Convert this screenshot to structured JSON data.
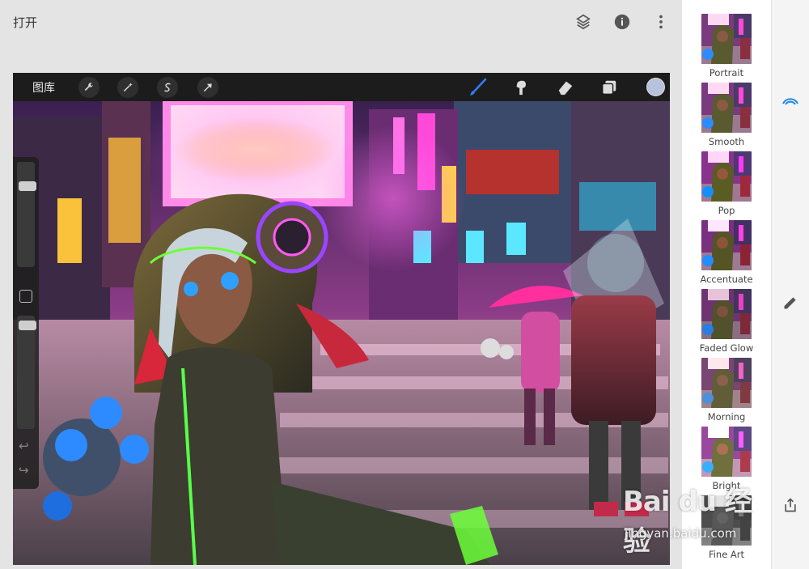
{
  "topbar": {
    "open_label": "打开",
    "icons": [
      "layers-swap-icon",
      "info-icon",
      "more-vert-icon"
    ]
  },
  "procreate": {
    "gallery_label": "图库",
    "tool_icons": [
      "wrench-icon",
      "magic-wand-icon",
      "selection-s-icon",
      "arrow-cursor-icon"
    ],
    "right_tools": [
      "brush-icon",
      "smudge-icon",
      "eraser-icon",
      "layers-icon"
    ],
    "current_color": "#b7c2dc",
    "undo_glyph": "↩",
    "redo_glyph": "↪"
  },
  "filters": {
    "items": [
      {
        "label": "Portrait"
      },
      {
        "label": "Smooth"
      },
      {
        "label": "Pop"
      },
      {
        "label": "Accentuate"
      },
      {
        "label": "Faded Glow"
      },
      {
        "label": "Morning"
      },
      {
        "label": "Bright"
      },
      {
        "label": "Fine Art"
      }
    ]
  },
  "right_strip": {
    "icons": [
      "rainbow-wifi-icon",
      "pencil-edit-icon",
      "share-icon"
    ]
  },
  "watermark": {
    "logo_text": "Bai du 经验",
    "url": "jingyan.baidu.com"
  }
}
